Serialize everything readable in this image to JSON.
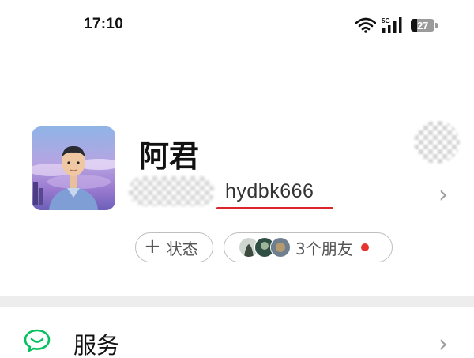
{
  "status_bar": {
    "time": "17:10",
    "network": "5G",
    "battery": "27",
    "battery_level": 0.27
  },
  "profile": {
    "name": "阿君",
    "wechat_id": "hydbk666",
    "status_button": "状态",
    "friends_text": "3个朋友",
    "avatar_icon": "person-avatar-icon"
  },
  "menu": {
    "items": [
      {
        "label": "服务",
        "icon": "service-icon"
      }
    ]
  },
  "colors": {
    "accent_red": "#d8262b",
    "wechat_green": "#07c160",
    "divider": "#ededed"
  }
}
